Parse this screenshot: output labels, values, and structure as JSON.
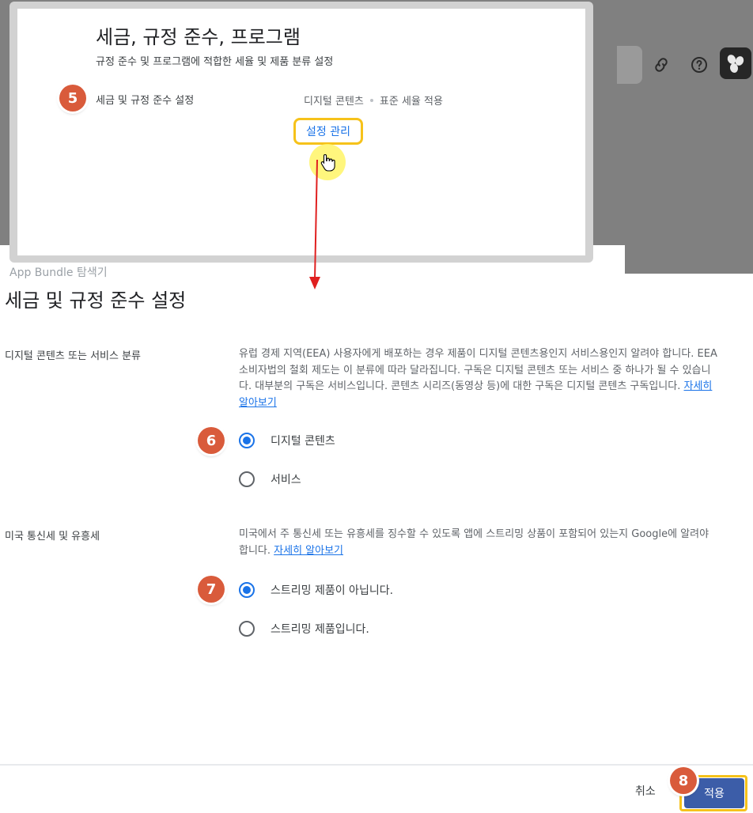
{
  "background": {
    "under_text": "App Bundle 탐색기"
  },
  "zoom_card": {
    "title": "세금, 규정 준수, 프로그램",
    "subtitle": "규정 준수 및 프로그램에 적합한 세율 및 제품 분류 설정",
    "row_label": "세금 및 규정 준수 설정",
    "row_value_1": "디지털 콘텐츠",
    "row_value_2": "표준 세율 적용",
    "manage_button": "설정 관리"
  },
  "steps": {
    "s5": "5",
    "s6": "6",
    "s7": "7",
    "s8": "8"
  },
  "dialog": {
    "title": "세금 및 규정 준수 설정",
    "section1": {
      "label": "디지털 콘텐츠 또는 서비스 분류",
      "description": "유럽 경제 지역(EEA) 사용자에게 배포하는 경우 제품이 디지털 콘텐츠용인지 서비스용인지 알려야 합니다. EEA 소비자법의 철회 제도는 이 분류에 따라 달라집니다. 구독은 디지털 콘텐츠 또는 서비스 중 하나가 될 수 있습니다. 대부분의 구독은 서비스입니다. 콘텐츠 시리즈(동영상 등)에 대한 구독은 디지털 콘텐츠 구독입니다. ",
      "link": "자세히 알아보기",
      "options": [
        "디지털 콘텐츠",
        "서비스"
      ],
      "selected": "디지털 콘텐츠"
    },
    "section2": {
      "label": "미국 통신세 및 유흥세",
      "description": "미국에서 주 통신세 또는 유흥세를 징수할 수 있도록 앱에 스트리밍 상품이 포함되어 있는지 Google에 알려야 합니다. ",
      "link": "자세히 알아보기",
      "options": [
        "스트리밍 제품이 아닙니다.",
        "스트리밍 제품입니다."
      ],
      "selected": "스트리밍 제품이 아닙니다."
    }
  },
  "footer": {
    "cancel": "취소",
    "apply": "적용"
  },
  "colors": {
    "accent_blue": "#1a73e8",
    "step_badge": "#d95b3b",
    "highlight_yellow": "#f6c21a",
    "apply_button": "#3c5da8",
    "arrow_red": "#e02020"
  }
}
